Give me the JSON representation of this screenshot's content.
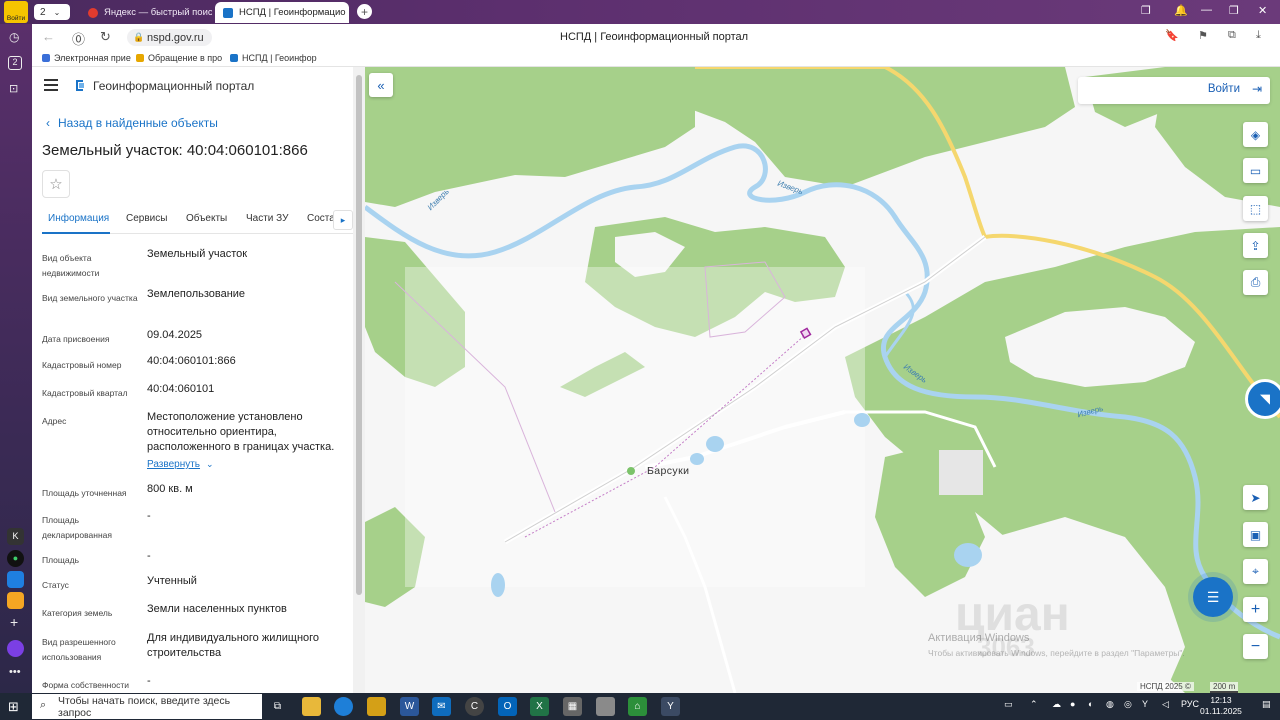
{
  "browser": {
    "profile_badge": "Войти",
    "tab_counter": "2",
    "tabs": [
      {
        "label": "Яндекс — быстрый поиск"
      },
      {
        "label": "НСПД | Геоинформацио"
      }
    ],
    "address": "nspd.gov.ru",
    "page_title": "НСПД | Геоинформационный портал",
    "bookmarks": [
      "Электронная прие",
      "Обращение в про",
      "НСПД | Геоинфор"
    ]
  },
  "panel": {
    "brand": "Геоинформационный портал",
    "back_label": "Назад в найденные объекты",
    "title": "Земельный участок: 40:04:060101:866",
    "tabs": [
      "Информация",
      "Сервисы",
      "Объекты",
      "Части ЗУ",
      "Соста"
    ],
    "expand_label": "Развернуть",
    "fields": [
      {
        "label": "Вид объекта недвижимости",
        "value": "Земельный участок"
      },
      {
        "label": "Вид земельного участка",
        "value": "Землепользование"
      },
      {
        "label": "Дата присвоения",
        "value": "09.04.2025"
      },
      {
        "label": "Кадастровый номер",
        "value": "40:04:060101:866"
      },
      {
        "label": "Кадастровый квартал",
        "value": "40:04:060101"
      },
      {
        "label": "Адрес",
        "value": "Местоположение установлено относительно ориентира, расположенного в границах участка."
      },
      {
        "label": "Площадь уточненная",
        "value": "800 кв. м"
      },
      {
        "label": "Площадь декларированная",
        "value": "-"
      },
      {
        "label": "Площадь",
        "value": "-"
      },
      {
        "label": "Статус",
        "value": "Учтенный"
      },
      {
        "label": "Категория земель",
        "value": "Земли населенных пунктов"
      },
      {
        "label": "Вид разрешенного использования",
        "value": "Для индивидуального жилищного строительства"
      },
      {
        "label": "Форма собственности",
        "value": "-"
      }
    ]
  },
  "map": {
    "login_label": "Войти",
    "place_label": "Барсуки",
    "river_labels": [
      "Изверь",
      "Изверь",
      "Изверь",
      "Изверь"
    ],
    "copyright": "НСПД 2025 ©",
    "scale_label": "200 m",
    "watermark_title": "Активация Windows",
    "watermark_text": "Чтобы активировать Windows, перейдите в раздел \"Параметры\".",
    "cian_logo": "циан",
    "cian_number": "3063",
    "colors": {
      "forest": "#a6d08a",
      "open": "#f6f6f6",
      "water": "#a9d3f0",
      "road_main": "#f5d76e"
    }
  },
  "taskbar": {
    "search_placeholder": "Чтобы начать поиск, введите здесь запрос",
    "lang": "РУС",
    "time": "12:13",
    "date": "01.11.2025"
  }
}
